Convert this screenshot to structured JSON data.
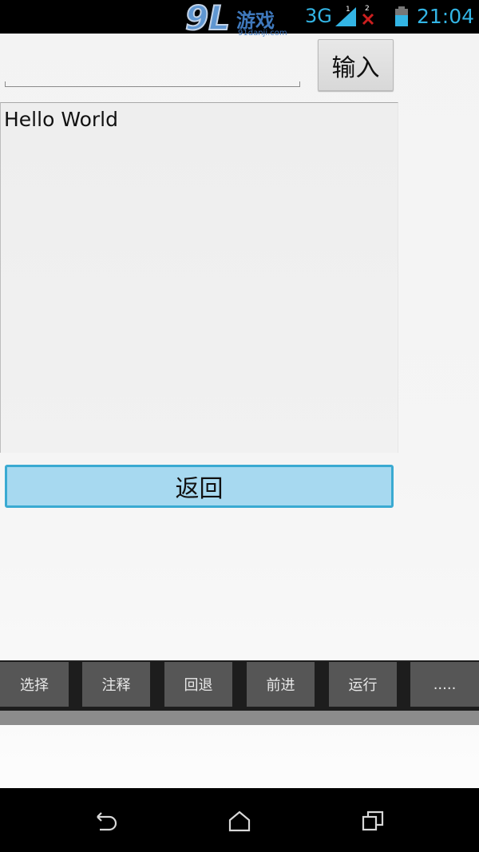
{
  "status_bar": {
    "watermark_logo": "9L",
    "watermark_text": "游戏",
    "watermark_site": "91danji.com",
    "network": "3G",
    "sim1_label": "1",
    "sim2_label": "2",
    "time": "21:04",
    "accent_color": "#33b5e5"
  },
  "form": {
    "input_value": "",
    "input_placeholder": "",
    "enter_button_label": "输入",
    "output_text": "Hello World",
    "back_button_label": "返回"
  },
  "toolbar": {
    "items": [
      {
        "label": "选择"
      },
      {
        "label": "注释"
      },
      {
        "label": "回退"
      },
      {
        "label": "前进"
      },
      {
        "label": "运行"
      },
      {
        "label": "....."
      }
    ]
  },
  "nav_bar": {
    "icons": [
      "back-icon",
      "home-icon",
      "recent-apps-icon"
    ]
  }
}
